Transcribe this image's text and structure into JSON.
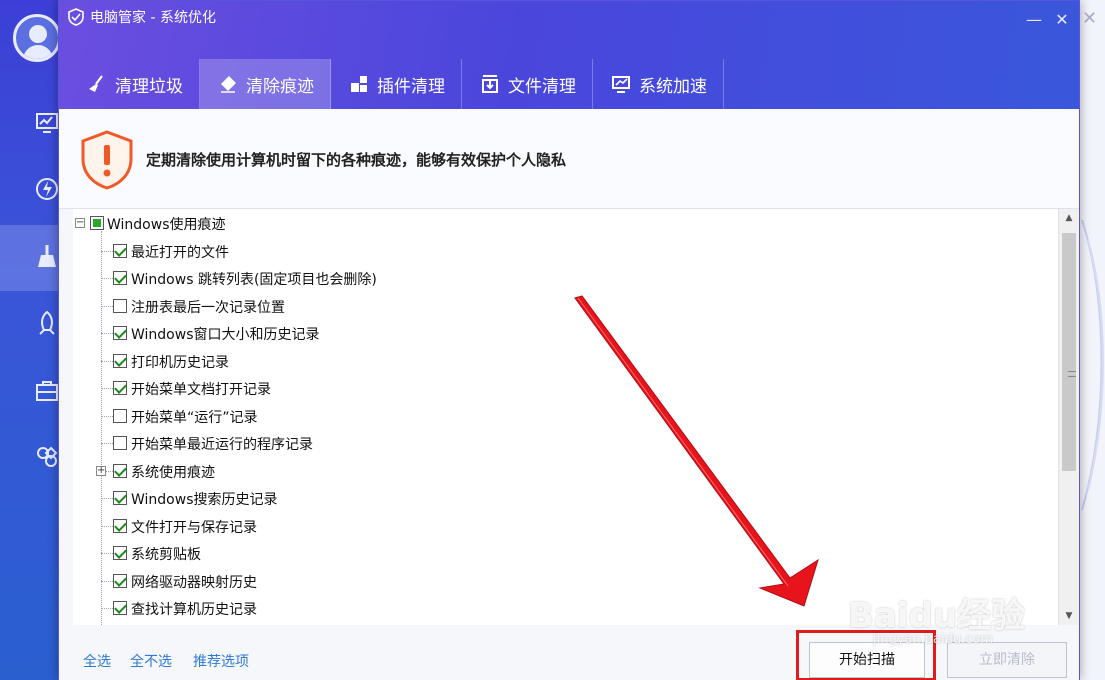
{
  "window": {
    "title": "电脑管家 - 系统优化"
  },
  "tabs": [
    {
      "label": "清理垃圾",
      "icon": "broom-icon",
      "active": false
    },
    {
      "label": "清除痕迹",
      "icon": "eraser-icon",
      "active": true
    },
    {
      "label": "插件清理",
      "icon": "plugin-icon",
      "active": false
    },
    {
      "label": "文件清理",
      "icon": "file-download-icon",
      "active": false
    },
    {
      "label": "系统加速",
      "icon": "monitor-speed-icon",
      "active": false
    }
  ],
  "notice": {
    "message": "定期清除使用计算机时留下的各种痕迹，能够有效保护个人隐私"
  },
  "tree": {
    "root": {
      "label": "Windows使用痕迹",
      "state": "partial"
    },
    "items": [
      {
        "label": "最近打开的文件",
        "checked": true
      },
      {
        "label": "Windows 跳转列表(固定项目也会删除)",
        "checked": true
      },
      {
        "label": "注册表最后一次记录位置",
        "checked": false
      },
      {
        "label": "Windows窗口大小和历史记录",
        "checked": true
      },
      {
        "label": "打印机历史记录",
        "checked": true
      },
      {
        "label": "开始菜单文档打开记录",
        "checked": true
      },
      {
        "label": "开始菜单“运行”记录",
        "checked": false
      },
      {
        "label": "开始菜单最近运行的程序记录",
        "checked": false
      },
      {
        "label": "系统使用痕迹",
        "checked": true,
        "expandable": true
      },
      {
        "label": "Windows搜索历史记录",
        "checked": true
      },
      {
        "label": "文件打开与保存记录",
        "checked": true
      },
      {
        "label": "系统剪贴板",
        "checked": true
      },
      {
        "label": "网络驱动器映射历史",
        "checked": true
      },
      {
        "label": "查找计算机历史记录",
        "checked": true
      }
    ]
  },
  "footer": {
    "select_all": "全选",
    "select_none": "全不选",
    "recommended": "推荐选项",
    "scan_button": "开始扫描",
    "clean_button": "立即清除"
  },
  "watermark": {
    "brand": "Baidu经验",
    "url": "jingyan.baidu.com"
  },
  "colors": {
    "accent": "#4a46dc",
    "annotation": "#e01b1b",
    "link": "#2f7ad6"
  }
}
